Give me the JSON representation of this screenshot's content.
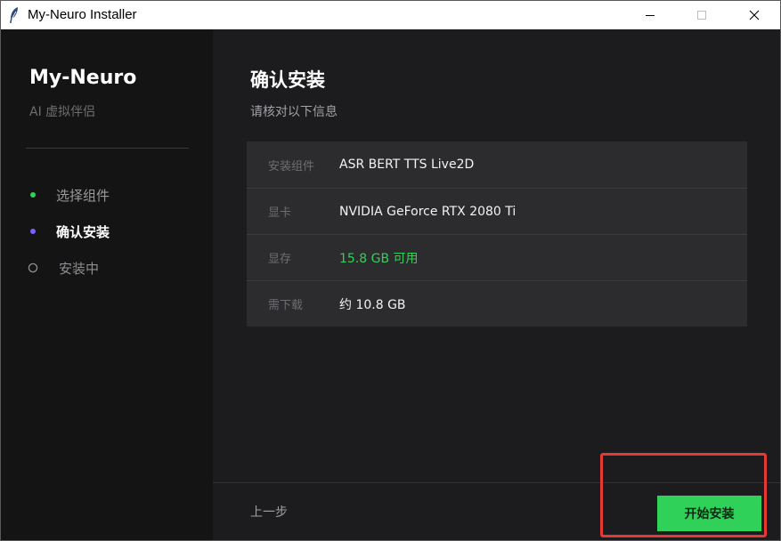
{
  "window": {
    "title": "My-Neuro Installer"
  },
  "sidebar": {
    "brand": "My-Neuro",
    "tagline": "AI 虚拟伴侣",
    "steps": [
      {
        "label": "选择组件",
        "state": "done"
      },
      {
        "label": "确认安装",
        "state": "active"
      },
      {
        "label": "安装中",
        "state": "pending"
      }
    ]
  },
  "main": {
    "title": "确认安装",
    "subtitle": "请核对以下信息",
    "info": [
      {
        "key": "安装组件",
        "value": "ASR  BERT  TTS  Live2D"
      },
      {
        "key": "显卡",
        "value": "NVIDIA GeForce RTX 2080 Ti"
      },
      {
        "key": "显存",
        "value": "15.8 GB 可用"
      },
      {
        "key": "需下载",
        "value": "约 10.8 GB"
      }
    ]
  },
  "footer": {
    "back_label": "上一步",
    "start_label": "开始安装"
  },
  "colors": {
    "accent_green": "#30d158",
    "accent_purple": "#7b61ff",
    "highlight_red": "#e53935"
  },
  "icons": {
    "app": "feather-icon",
    "minimize": "minimize-icon",
    "maximize": "maximize-icon",
    "close": "close-icon"
  }
}
